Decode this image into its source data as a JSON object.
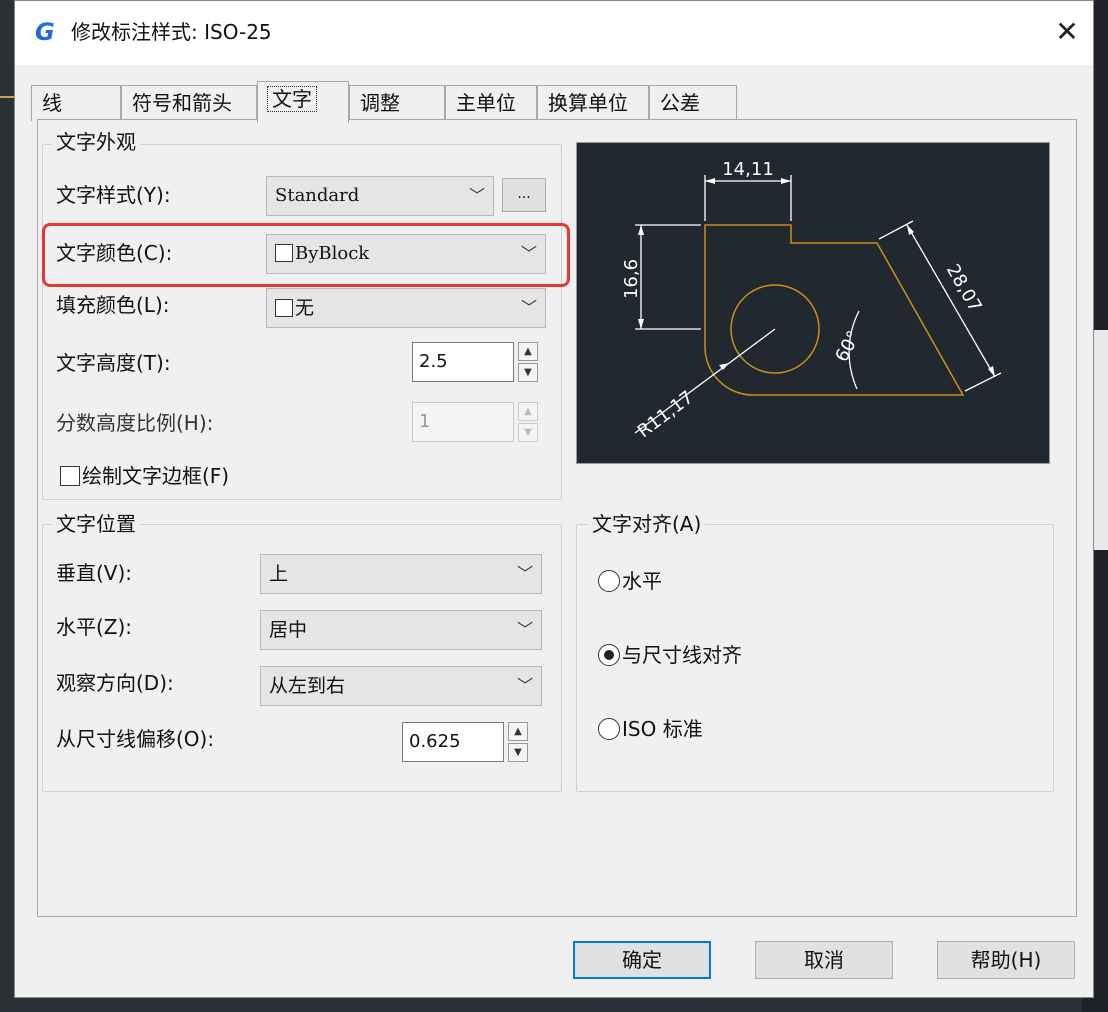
{
  "dialog": {
    "title": "修改标注样式: ISO-25",
    "close_glyph": "✕"
  },
  "tabs": [
    {
      "label": "线"
    },
    {
      "label": "符号和箭头"
    },
    {
      "label": "文字"
    },
    {
      "label": "调整"
    },
    {
      "label": "主单位"
    },
    {
      "label": "换算单位"
    },
    {
      "label": "公差"
    }
  ],
  "active_tab": "文字",
  "appearance": {
    "group_title": "文字外观",
    "text_style_label": "文字样式(Y):",
    "text_style_value": "Standard",
    "browse_label": "...",
    "text_color_label": "文字颜色(C):",
    "text_color_value": "ByBlock",
    "fill_color_label": "填充颜色(L):",
    "fill_color_value": "无",
    "text_height_label": "文字高度(T):",
    "text_height_value": "2.5",
    "fraction_scale_label": "分数高度比例(H):",
    "fraction_scale_value": "1",
    "draw_frame_label": "绘制文字边框(F)",
    "draw_frame_checked": false
  },
  "placement": {
    "group_title": "文字位置",
    "vertical_label": "垂直(V):",
    "vertical_value": "上",
    "horizontal_label": "水平(Z):",
    "horizontal_value": "居中",
    "view_dir_label": "观察方向(D):",
    "view_dir_value": "从左到右",
    "offset_label": "从尺寸线偏移(O):",
    "offset_value": "0.625"
  },
  "alignment": {
    "group_title": "文字对齐(A)",
    "options": [
      {
        "label": "水平",
        "checked": false
      },
      {
        "label": "与尺寸线对齐",
        "checked": true
      },
      {
        "label": "ISO 标准",
        "checked": false
      }
    ]
  },
  "preview": {
    "dim_top": "14,11",
    "dim_left": "16,6",
    "dim_diag": "28,07",
    "dim_angle": "60°",
    "dim_radius": "R11,17",
    "bg_color": "#212830",
    "line_color": "#c8901a",
    "dim_color": "#ffffff"
  },
  "buttons": {
    "ok": "确定",
    "cancel": "取消",
    "help": "帮助(H)"
  },
  "colors": {
    "highlight": "#e53935",
    "accent": "#0078d7"
  }
}
